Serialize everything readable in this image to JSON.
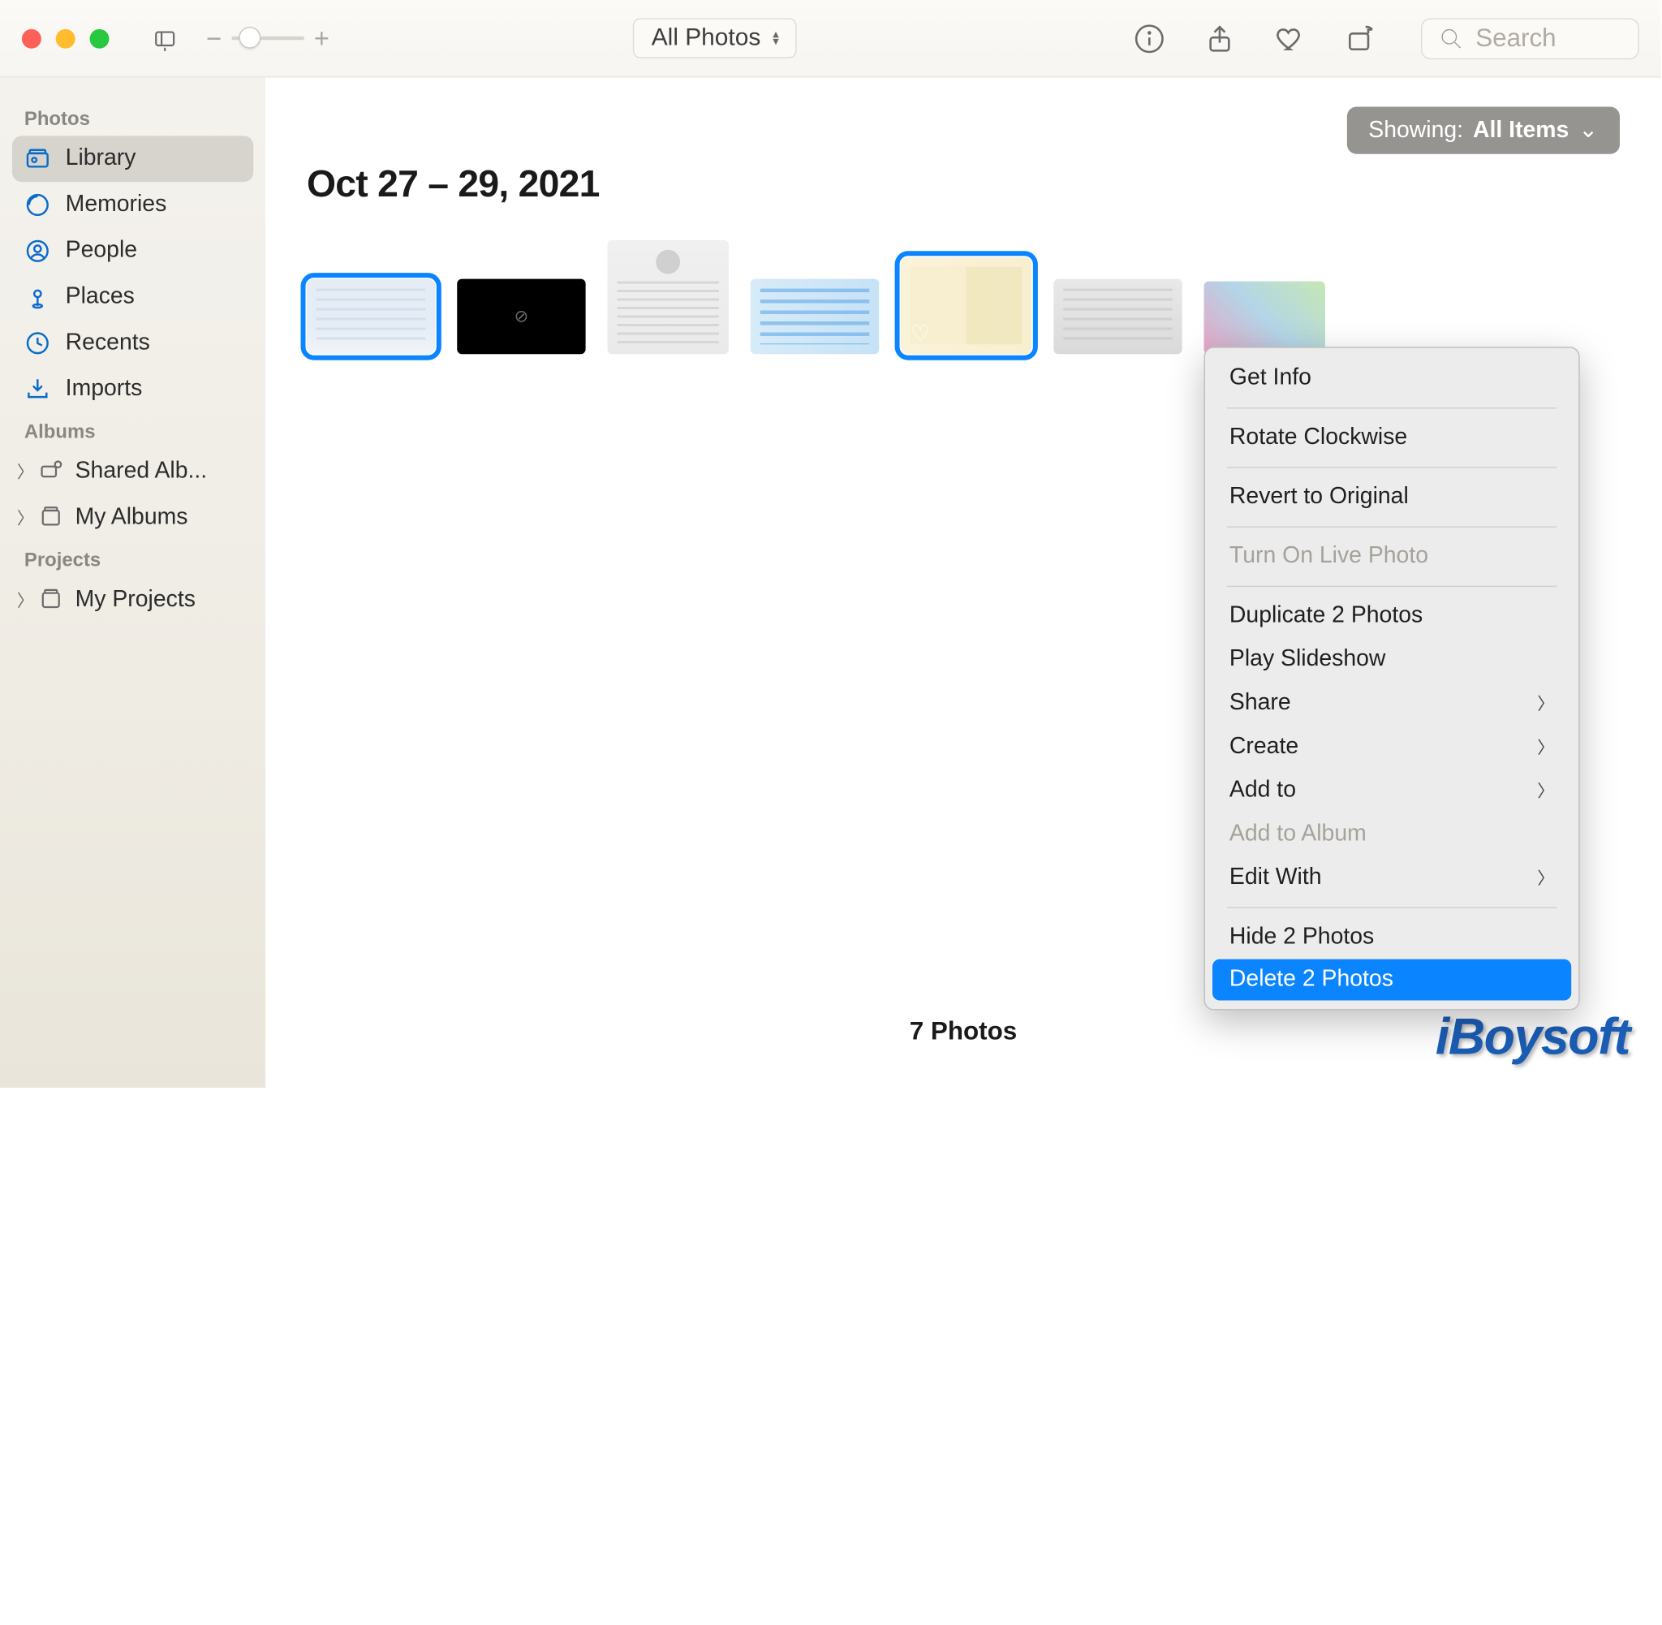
{
  "toolbar": {
    "view_dropdown": "All Photos",
    "search_placeholder": "Search"
  },
  "showing": {
    "label": "Showing:",
    "value": "All Items"
  },
  "sidebar": {
    "sections": {
      "photos": "Photos",
      "albums": "Albums",
      "projects": "Projects"
    },
    "items": {
      "library": "Library",
      "memories": "Memories",
      "people": "People",
      "places": "Places",
      "recents": "Recents",
      "imports": "Imports",
      "shared_albums": "Shared Alb...",
      "my_albums": "My Albums",
      "my_projects": "My Projects"
    }
  },
  "content": {
    "date_header": "Oct 27 – 29, 2021",
    "footer_count": "7 Photos"
  },
  "context_menu": {
    "get_info": "Get Info",
    "rotate_clockwise": "Rotate Clockwise",
    "revert_original": "Revert to Original",
    "turn_on_live": "Turn On Live Photo",
    "duplicate": "Duplicate 2 Photos",
    "play_slideshow": "Play Slideshow",
    "share": "Share",
    "create": "Create",
    "add_to": "Add to",
    "add_to_album": "Add to Album",
    "edit_with": "Edit With",
    "hide": "Hide 2 Photos",
    "delete": "Delete 2 Photos"
  },
  "watermark": "iBoysoft"
}
